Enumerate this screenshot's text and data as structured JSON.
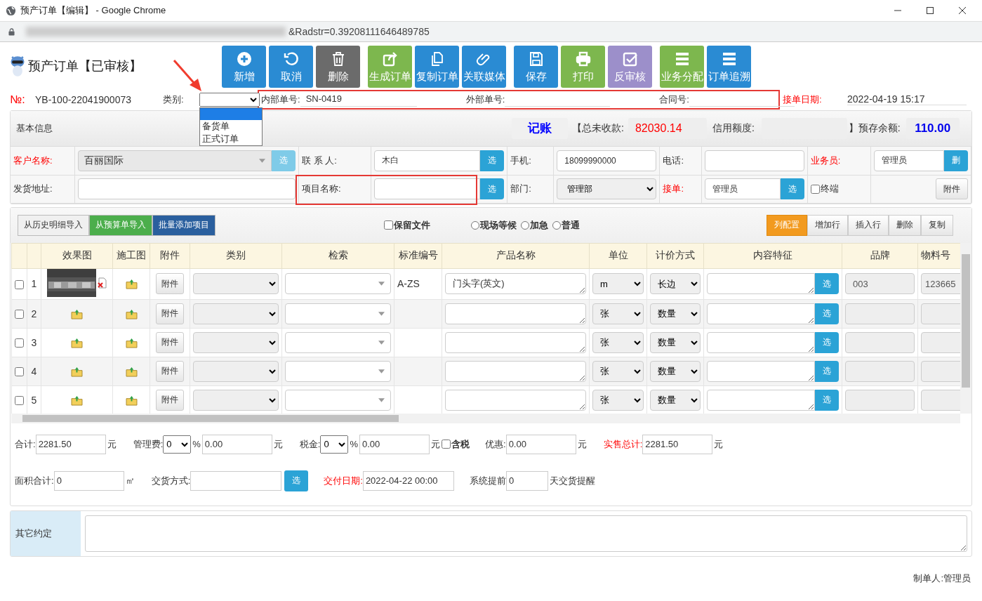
{
  "window": {
    "title": "预产订单【编辑】 - Google Chrome"
  },
  "address_bar": {
    "url": "&Radstr=0.39208111646489785"
  },
  "page_title": "预产订单【已审核】",
  "toolbar": [
    [
      {
        "label": "新增",
        "kind": "plus",
        "color": "#2a8bd3"
      },
      {
        "label": "取消",
        "kind": "undo",
        "color": "#2a8bd3"
      },
      {
        "label": "删除",
        "kind": "trash",
        "color": "#6b6b6b"
      }
    ],
    [
      {
        "label": "生成订单",
        "kind": "share",
        "color": "#7db74e"
      },
      {
        "label": "复制订单",
        "kind": "copy",
        "color": "#2a8bd3"
      },
      {
        "label": "关联媒体",
        "kind": "clip",
        "color": "#2a8bd3"
      }
    ],
    [
      {
        "label": "保存",
        "kind": "save",
        "color": "#2a8bd3"
      },
      {
        "label": "打印",
        "kind": "print",
        "color": "#7db74e"
      },
      {
        "label": "反审核",
        "kind": "check",
        "color": "#9c8fca"
      }
    ],
    [
      {
        "label": "业务分配",
        "kind": "list",
        "color": "#7db74e"
      },
      {
        "label": "订单追溯",
        "kind": "list",
        "color": "#2a8bd3"
      }
    ]
  ],
  "order_header": {
    "number_label": "№:",
    "number": "YB-100-22041900073",
    "category": {
      "label": "类别:",
      "open": true,
      "blank_highlighted": true,
      "options": [
        {
          "label": "备货单",
          "selected": false
        },
        {
          "label": "正式订单",
          "selected": false
        }
      ]
    },
    "highlighted_fields": [
      {
        "label": "内部单号:",
        "value": "SN-0419"
      },
      {
        "label": "外部单号:"
      },
      {
        "label": "合同号:"
      }
    ],
    "date_label": "接单日期:",
    "date": "2022-04-19 15:17"
  },
  "info_bar": {
    "title": "基本信息",
    "booking": "记账",
    "unpaid_label": "【总未收款:",
    "unpaid": "82030.14",
    "credit_label": "信用额度:",
    "balance_label": "】预存余额:",
    "balance": "110.00"
  },
  "basic_form": {
    "rows": [
      {
        "cells": [
          {
            "kind": "label",
            "text": "客户名称:",
            "required": true
          },
          {
            "kind": "combo",
            "value": "百丽国际",
            "button": "选"
          },
          {
            "kind": "label",
            "text": "联 系 人:",
            "required": false
          },
          {
            "kind": "input",
            "value": "木白",
            "button": "选"
          },
          {
            "kind": "label",
            "text": "手机:",
            "required": false
          },
          {
            "kind": "input",
            "value": "18099990000"
          },
          {
            "kind": "label",
            "text": "电话:",
            "required": false
          },
          {
            "kind": "input"
          },
          {
            "kind": "label",
            "text": "业务员:",
            "required": true
          },
          {
            "kind": "input",
            "value": "管理员",
            "button": "删"
          }
        ]
      },
      {
        "cells": [
          {
            "kind": "label",
            "text": "发货地址:",
            "required": false
          },
          {
            "kind": "input"
          },
          {
            "kind": "label",
            "text": "项目名称:",
            "required": false,
            "highlighted": true
          },
          {
            "kind": "input",
            "button": "选"
          },
          {
            "kind": "label",
            "text": "部门:",
            "required": false
          },
          {
            "kind": "select",
            "value": "管理部"
          },
          {
            "kind": "label",
            "text": "接单:",
            "required": true
          },
          {
            "kind": "input",
            "value": "管理员",
            "button": "选"
          },
          {
            "kind": "checkbox",
            "text": "终端",
            "checked": false
          },
          {
            "kind": "button",
            "text": "附件"
          }
        ]
      }
    ]
  },
  "detail_toolbar": {
    "import_buttons": [
      {
        "label": "从历史明细导入",
        "color": "#f0f0f0"
      },
      {
        "label": "从预算单导入",
        "color": "#4cae4c"
      },
      {
        "label": "批量添加项目",
        "color": "#2a5f9e"
      }
    ],
    "keep_files": {
      "label": "保留文件",
      "checked": false
    },
    "priority": [
      {
        "label": "现场等候",
        "selected": false
      },
      {
        "label": "加急",
        "selected": false
      },
      {
        "label": "普通",
        "selected": false
      }
    ],
    "row_actions": [
      {
        "label": "列配置",
        "selected": true
      },
      {
        "label": "增加行",
        "selected": false
      },
      {
        "label": "插入行",
        "selected": false
      },
      {
        "label": "删除",
        "selected": false
      },
      {
        "label": "复制",
        "selected": false
      }
    ]
  },
  "items": {
    "columns": [
      "效果图",
      "施工图",
      "附件",
      "类别",
      "检索",
      "标准编号",
      "产品名称",
      "单位",
      "计价方式",
      "内容特征",
      "品牌",
      "物料号"
    ],
    "rows": [
      {
        "checked": false,
        "index": "1",
        "effect_image": true,
        "attachment": "附件",
        "standard_no": "A-ZS",
        "product_name": "门头字(英文)",
        "unit": "m",
        "pricing": "长边",
        "pick": "选",
        "brand": "003",
        "material_no": "123665"
      },
      {
        "checked": false,
        "index": "2",
        "effect_image": false,
        "attachment": "附件",
        "unit": "张",
        "pricing": "数量",
        "pick": "选"
      },
      {
        "checked": false,
        "index": "3",
        "effect_image": false,
        "attachment": "附件",
        "unit": "张",
        "pricing": "数量",
        "pick": "选"
      },
      {
        "checked": false,
        "index": "4",
        "effect_image": false,
        "attachment": "附件",
        "unit": "张",
        "pricing": "数量",
        "pick": "选"
      },
      {
        "checked": false,
        "index": "5",
        "effect_image": false,
        "attachment": "附件",
        "unit": "张",
        "pricing": "数量",
        "pick": "选"
      }
    ]
  },
  "totals": {
    "lines": [
      {
        "parts": [
          {
            "kind": "label",
            "text": "合计:"
          },
          {
            "kind": "input",
            "value": "2281.50"
          },
          {
            "kind": "unit",
            "text": "元"
          },
          {
            "kind": "label",
            "text": "管理费:"
          },
          {
            "kind": "select",
            "value": "0"
          },
          {
            "kind": "unit",
            "text": "%"
          },
          {
            "kind": "input",
            "value": "0.00"
          },
          {
            "kind": "unit",
            "text": "元"
          },
          {
            "kind": "label",
            "text": "税金:"
          },
          {
            "kind": "select",
            "value": "0"
          },
          {
            "kind": "unit",
            "text": "%"
          },
          {
            "kind": "input",
            "value": "0.00"
          },
          {
            "kind": "unit",
            "text": "元"
          },
          {
            "kind": "checkbox",
            "text": "含税",
            "checked": false
          },
          {
            "kind": "label",
            "text": "优惠:"
          },
          {
            "kind": "input",
            "value": "0.00"
          },
          {
            "kind": "unit",
            "text": "元"
          },
          {
            "kind": "label",
            "text": "实售总计:",
            "required": true
          },
          {
            "kind": "input",
            "value": "2281.50"
          },
          {
            "kind": "unit",
            "text": "元"
          }
        ]
      },
      {
        "parts": [
          {
            "kind": "label",
            "text": "面积合计:"
          },
          {
            "kind": "input",
            "value": "0"
          },
          {
            "kind": "unit",
            "text": "㎡"
          },
          {
            "kind": "label",
            "text": "交货方式:"
          },
          {
            "kind": "input",
            "wide": true
          },
          {
            "kind": "button",
            "text": "选"
          },
          {
            "kind": "label",
            "text": "交付日期:",
            "required": true
          },
          {
            "kind": "input",
            "value": "2022-04-22 00:00",
            "wide": true
          },
          {
            "kind": "label",
            "text": "系统提前"
          },
          {
            "kind": "input",
            "value": "0",
            "narrow": true
          },
          {
            "kind": "unit",
            "text": "天交货提醒"
          }
        ]
      }
    ]
  },
  "other_terms": {
    "label": "其它约定"
  },
  "footer": {
    "maker_label": "制单人:",
    "maker": "管理员"
  }
}
